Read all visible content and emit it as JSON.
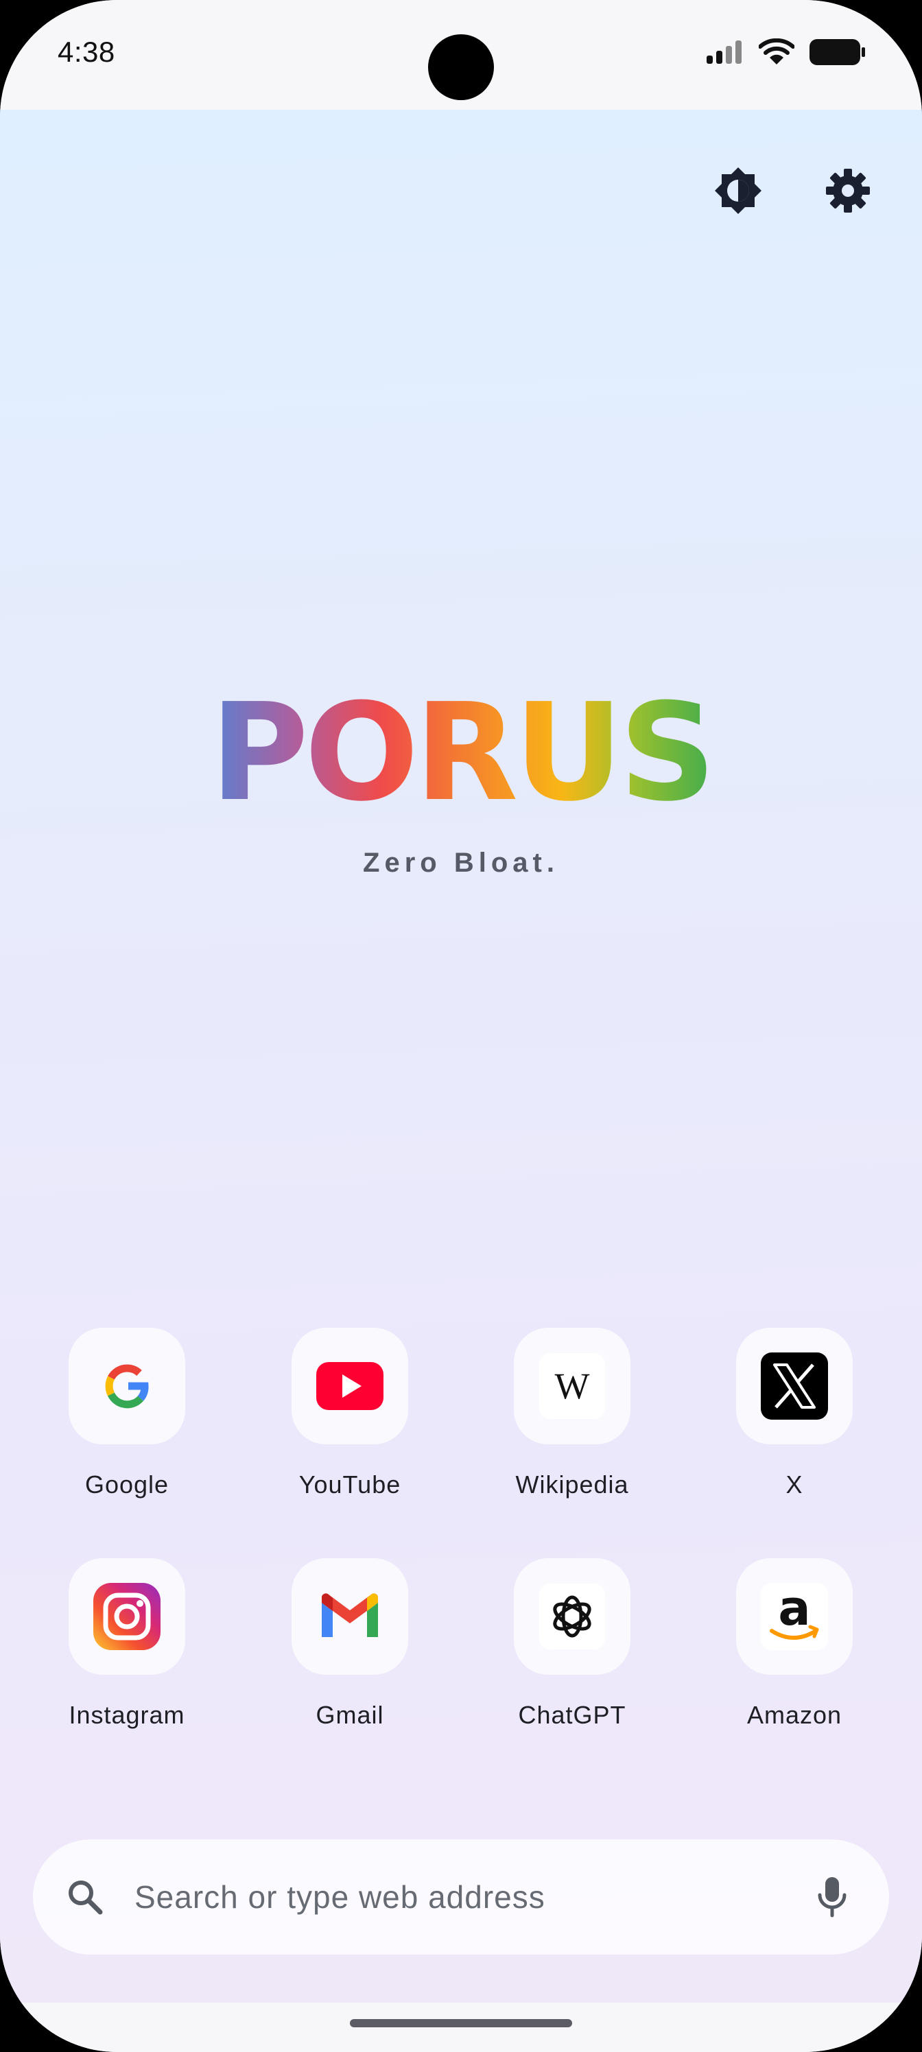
{
  "status_bar": {
    "time": "4:38"
  },
  "brand": {
    "title": "PORUS",
    "tagline": "Zero Bloat."
  },
  "shortcuts": [
    {
      "label": "Google",
      "icon": "google-icon"
    },
    {
      "label": "YouTube",
      "icon": "youtube-icon"
    },
    {
      "label": "Wikipedia",
      "icon": "wikipedia-icon",
      "glyph": "W"
    },
    {
      "label": "X",
      "icon": "x-icon"
    },
    {
      "label": "Instagram",
      "icon": "instagram-icon"
    },
    {
      "label": "Gmail",
      "icon": "gmail-icon"
    },
    {
      "label": "ChatGPT",
      "icon": "chatgpt-icon"
    },
    {
      "label": "Amazon",
      "icon": "amazon-icon",
      "glyph": "a"
    }
  ],
  "search": {
    "placeholder": "Search or type web address",
    "value": ""
  },
  "colors": {
    "brand_gradient": [
      "#5b7fd0",
      "#ef4b4b",
      "#f8b616",
      "#43ad4c"
    ],
    "youtube_red": "#ff0033",
    "instagram_gradient": [
      "#fdc830",
      "#f5512f",
      "#d62976",
      "#962fbf"
    ]
  }
}
